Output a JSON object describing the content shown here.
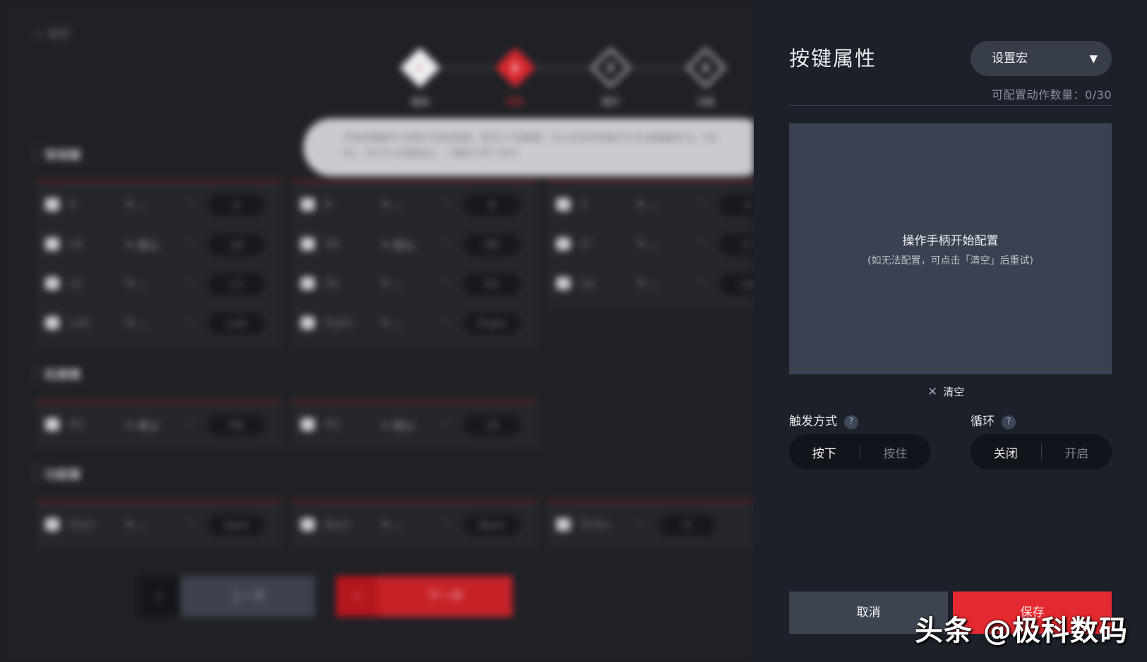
{
  "background": {
    "back_link": "< 返回",
    "steps": [
      {
        "mark": "✓",
        "label": "基础"
      },
      {
        "mark": "2",
        "label": "映射"
      },
      {
        "mark": "3",
        "label": "摇杆"
      },
      {
        "mark": "4",
        "label": "功能"
      }
    ],
    "hint_text": "所有按键都可以映射为其他按键，配合2个拓展键，可以实现多种操作方式(按键属性LB、RB、M1、M2可以设置组合，一键执行多个动作",
    "sections": [
      {
        "title": "常规键"
      },
      {
        "title": "拓展键"
      },
      {
        "title": "功能键"
      }
    ],
    "regular_keys": [
      [
        {
          "name": "A",
          "edit": "…",
          "value": "A"
        },
        {
          "name": "LB",
          "edit": "默认",
          "value": "LB"
        },
        {
          "name": "LS",
          "edit": "…",
          "value": "LS"
        },
        {
          "name": "Left",
          "edit": "…",
          "value": "Left"
        }
      ],
      [
        {
          "name": "B",
          "edit": "…",
          "value": "B"
        },
        {
          "name": "RB",
          "edit": "默认",
          "value": "RB"
        },
        {
          "name": "RS",
          "edit": "…",
          "value": "RS"
        },
        {
          "name": "Right",
          "edit": "…",
          "value": "Right"
        }
      ],
      [
        {
          "name": "X",
          "edit": "…",
          "value": "X"
        },
        {
          "name": "LT",
          "edit": "…",
          "value": "LT"
        },
        {
          "name": "Up",
          "edit": "…",
          "value": "Up"
        }
      ]
    ],
    "extension_keys": [
      {
        "name": "M1",
        "edit": "默认",
        "value": "RB"
      },
      {
        "name": "M2",
        "edit": "默认",
        "value": "LB"
      }
    ],
    "function_keys": [
      {
        "name": "Start",
        "edit": "…",
        "value": "Start"
      },
      {
        "name": "Back",
        "edit": "…",
        "value": "Back"
      },
      {
        "name": "Turbo",
        "edit": "",
        "value": "R"
      }
    ],
    "prev_label": "上一步",
    "next_label": "下一步"
  },
  "panel": {
    "title": "按键属性",
    "mode_select": "设置宏",
    "count_label": "可配置动作数量：",
    "count_value": "0/30",
    "macro_prompt": "操作手柄开始配置",
    "macro_hint": "(如无法配置，可点击「清空」后重试)",
    "clear_label": "清空",
    "trigger": {
      "title": "触发方式",
      "options": [
        "按下",
        "按住"
      ],
      "selected": "按下"
    },
    "loop": {
      "title": "循环",
      "options": [
        "关闭",
        "开启"
      ],
      "selected": "关闭"
    },
    "cancel_label": "取消",
    "save_label": "保存"
  },
  "watermark": "头条 @极科数码",
  "colors": {
    "accent": "#e42a30",
    "panel_bg": "#1c2029",
    "macro_bg": "#3a4252"
  }
}
